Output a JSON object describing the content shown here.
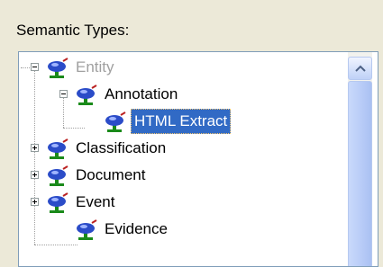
{
  "group": {
    "label": "Semantic Types:"
  },
  "tree": {
    "items": [
      {
        "label": "Entity",
        "state": "disabled",
        "expanded": true
      },
      {
        "label": "Annotation",
        "state": "normal",
        "expanded": true
      },
      {
        "label": "HTML Extract",
        "state": "selected"
      },
      {
        "label": "Classification",
        "state": "normal",
        "expanded": false
      },
      {
        "label": "Document",
        "state": "normal",
        "expanded": false
      },
      {
        "label": "Event",
        "state": "normal",
        "expanded": false
      },
      {
        "label": "Evidence",
        "state": "normal"
      }
    ],
    "icon": "semantic-type-icon"
  },
  "colors": {
    "selection": "#316ac5",
    "border": "#7f9db9",
    "disabled_text": "#a0a0a0"
  }
}
